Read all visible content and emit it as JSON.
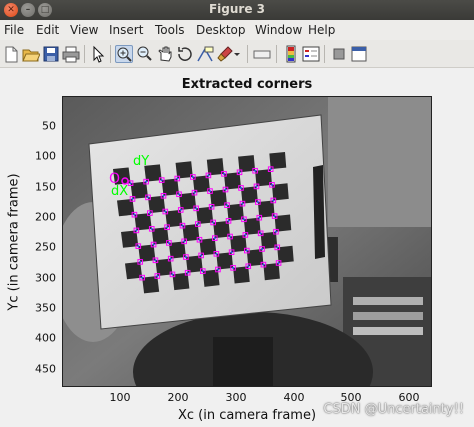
{
  "window": {
    "title": "Figure 3"
  },
  "menu": [
    "File",
    "Edit",
    "View",
    "Insert",
    "Tools",
    "Desktop",
    "Window",
    "Help"
  ],
  "toolbar": {
    "icons": [
      "new-figure-icon",
      "open-file-icon",
      "save-icon",
      "print-icon",
      "edit-plot-icon",
      "zoom-in-icon",
      "zoom-out-icon",
      "pan-icon",
      "rotate-3d-icon",
      "data-cursor-icon",
      "brush-icon",
      "colorbar-icon",
      "legend-icon",
      "hide-plot-tools-icon",
      "show-plot-tools-icon"
    ],
    "active_tool": "zoom-in-icon"
  },
  "plot": {
    "title": "Extracted corners",
    "xlabel": "Xc (in camera frame)",
    "ylabel": "Yc (in camera frame)",
    "xticks": [
      "100",
      "200",
      "300",
      "400",
      "500",
      "600"
    ],
    "yticks": [
      "50",
      "100",
      "150",
      "200",
      "250",
      "300",
      "350",
      "400",
      "450"
    ],
    "xlim": [
      0,
      640
    ],
    "ylim": [
      0,
      480
    ],
    "annotations": {
      "origin": "O",
      "dx": "dX",
      "dy": "dY"
    },
    "marker_color": "#ff00ff",
    "text_color": "#00ff00"
  },
  "watermark": "CSDN @Uncertainty!!"
}
